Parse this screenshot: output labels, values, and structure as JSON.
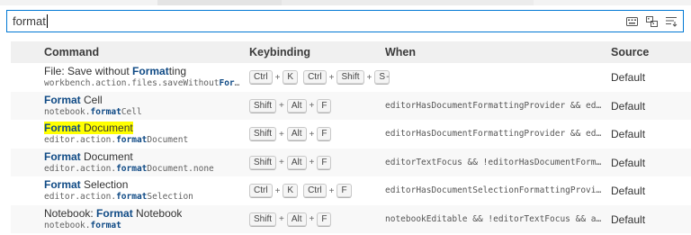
{
  "search": {
    "value": "format"
  },
  "header": {
    "command": "Command",
    "keybinding": "Keybinding",
    "when": "When",
    "source": "Source"
  },
  "rows": [
    {
      "title_pre": "File: Save without ",
      "title_hl": "Format",
      "title_post": "ting",
      "id_pre": "workbench.action.files.saveWithout",
      "id_hl": "Format",
      "id_post": "t...",
      "keys": [
        "Ctrl",
        "+",
        "K",
        "Ctrl",
        "+",
        "Shift",
        "+",
        "S"
      ],
      "when": "-",
      "source": "Default"
    },
    {
      "title_pre": "",
      "title_hl": "Format",
      "title_post": " Cell",
      "id_pre": "notebook.",
      "id_hl": "format",
      "id_post": "Cell",
      "keys": [
        "Shift",
        "+",
        "Alt",
        "+",
        "F"
      ],
      "when": "editorHasDocumentFormattingProvider && editorT...",
      "source": "Default"
    },
    {
      "title_pre": "",
      "title_hl": "Format",
      "title_post": " Document",
      "id_pre": "editor.action.",
      "id_hl": "format",
      "id_post": "Document",
      "keys": [
        "Shift",
        "+",
        "Alt",
        "+",
        "F"
      ],
      "when": "editorHasDocumentFormattingProvider && editorT...",
      "source": "Default"
    },
    {
      "title_pre": "",
      "title_hl": "Format",
      "title_post": " Document",
      "id_pre": "editor.action.",
      "id_hl": "format",
      "id_post": "Document.none",
      "keys": [
        "Shift",
        "+",
        "Alt",
        "+",
        "F"
      ],
      "when": "editorTextFocus && !editorHasDocumentFormattin...",
      "source": "Default"
    },
    {
      "title_pre": "",
      "title_hl": "Format",
      "title_post": " Selection",
      "id_pre": "editor.action.",
      "id_hl": "format",
      "id_post": "Selection",
      "keys": [
        "Ctrl",
        "+",
        "K",
        "Ctrl",
        "+",
        "F"
      ],
      "when": "editorHasDocumentSelectionFormattingProvider &...",
      "source": "Default"
    },
    {
      "title_pre": "Notebook: ",
      "title_hl": "Format",
      "title_post": " Notebook",
      "id_pre": "notebook.",
      "id_hl": "format",
      "id_post": "",
      "keys": [
        "Shift",
        "+",
        "Alt",
        "+",
        "F"
      ],
      "when": "notebookEditable && !editorTextFocus && active...",
      "source": "Default"
    }
  ],
  "icons": {
    "keyboard": "keyboard-icon",
    "record": "record-keys-icon",
    "sort": "sort-precedence-icon"
  },
  "colors": {
    "focus_border": "#0078d4",
    "highlight": "#0f4a85",
    "yellow": "#ffff00"
  }
}
